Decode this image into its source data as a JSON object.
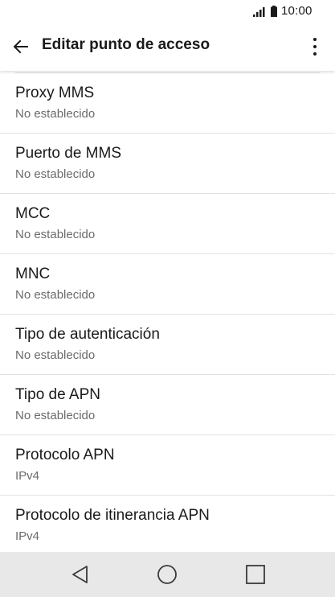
{
  "status_bar": {
    "time": "10:00",
    "signal_icon": "signal-icon",
    "battery_icon": "battery-icon"
  },
  "app_bar": {
    "title": "Editar punto de acceso",
    "back_icon": "arrow-back-icon",
    "menu_icon": "more-vert-icon"
  },
  "settings": [
    {
      "label": "Proxy MMS",
      "value": "No establecido"
    },
    {
      "label": "Puerto de MMS",
      "value": "No establecido"
    },
    {
      "label": "MCC",
      "value": "No establecido"
    },
    {
      "label": "MNC",
      "value": "No establecido"
    },
    {
      "label": "Tipo de autenticación",
      "value": "No establecido"
    },
    {
      "label": "Tipo de APN",
      "value": "No establecido"
    },
    {
      "label": "Protocolo APN",
      "value": "IPv4"
    },
    {
      "label": "Protocolo de itinerancia APN",
      "value": "IPv4"
    }
  ],
  "nav_bar": {
    "back_icon": "nav-back-icon",
    "home_icon": "nav-home-icon",
    "recents_icon": "nav-recents-icon"
  },
  "colors": {
    "background": "#ffffff",
    "text_primary": "#1a1a1a",
    "text_secondary": "#6b6b6b",
    "divider": "#e3e3e3",
    "nav_bar": "#e8e8e8"
  }
}
